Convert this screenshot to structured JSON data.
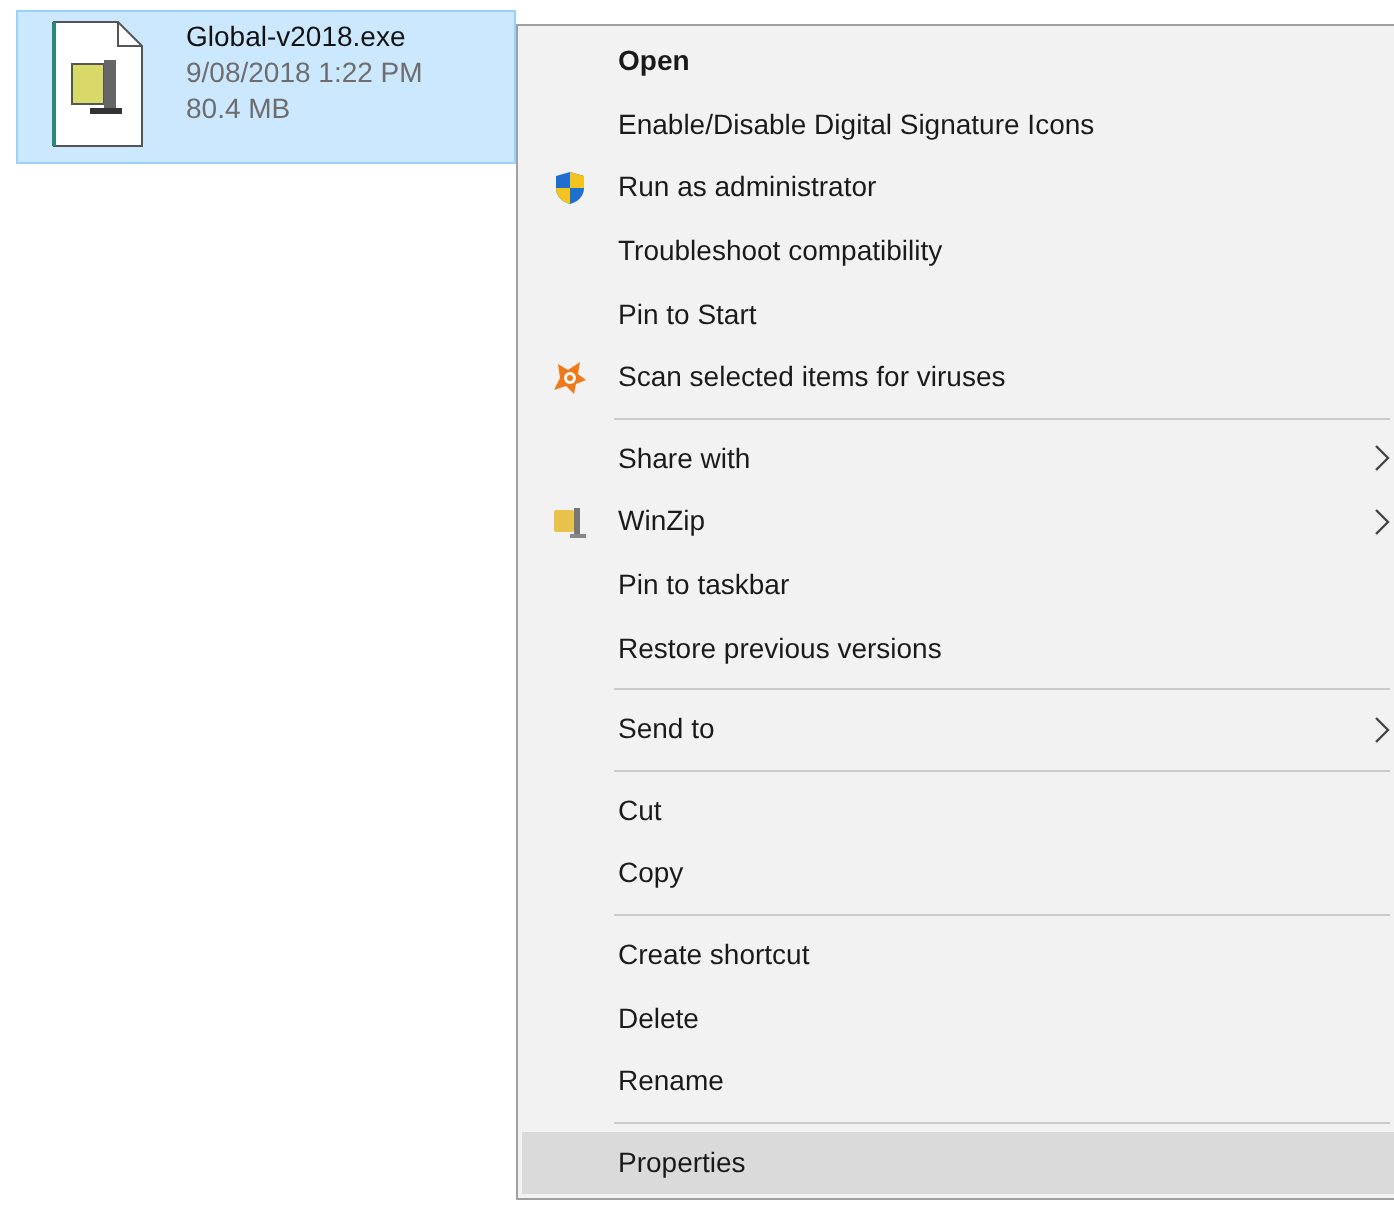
{
  "file": {
    "name": "Global-v2018.exe",
    "modified": "9/08/2018 1:22 PM",
    "size": "80.4 MB",
    "selected": true
  },
  "menu": {
    "groups": [
      [
        {
          "label": "Open",
          "kind": "plain",
          "default": true,
          "submenu": false,
          "selected": false
        },
        {
          "label": "Enable/Disable Digital Signature Icons",
          "kind": "plain",
          "default": false,
          "submenu": false,
          "selected": false
        },
        {
          "label": "Run as administrator",
          "kind": "elevated",
          "default": false,
          "submenu": false,
          "selected": false
        },
        {
          "label": "Troubleshoot compatibility",
          "kind": "plain",
          "default": false,
          "submenu": false,
          "selected": false
        },
        {
          "label": "Pin to Start",
          "kind": "plain",
          "default": false,
          "submenu": false,
          "selected": false
        },
        {
          "label": "Scan selected items for viruses",
          "kind": "scan",
          "default": false,
          "submenu": false,
          "selected": false
        }
      ],
      [
        {
          "label": "Share with",
          "kind": "plain",
          "default": false,
          "submenu": true,
          "selected": false
        },
        {
          "label": "WinZip",
          "kind": "archive",
          "default": false,
          "submenu": true,
          "selected": false
        },
        {
          "label": "Pin to taskbar",
          "kind": "plain",
          "default": false,
          "submenu": false,
          "selected": false
        },
        {
          "label": "Restore previous versions",
          "kind": "plain",
          "default": false,
          "submenu": false,
          "selected": false
        }
      ],
      [
        {
          "label": "Send to",
          "kind": "plain",
          "default": false,
          "submenu": true,
          "selected": false
        }
      ],
      [
        {
          "label": "Cut",
          "kind": "plain",
          "default": false,
          "submenu": false,
          "selected": false
        },
        {
          "label": "Copy",
          "kind": "plain",
          "default": false,
          "submenu": false,
          "selected": false
        }
      ],
      [
        {
          "label": "Create shortcut",
          "kind": "plain",
          "default": false,
          "submenu": false,
          "selected": false
        },
        {
          "label": "Delete",
          "kind": "plain",
          "default": false,
          "submenu": false,
          "selected": false
        },
        {
          "label": "Rename",
          "kind": "plain",
          "default": false,
          "submenu": false,
          "selected": false
        }
      ],
      [
        {
          "label": "Properties",
          "kind": "plain",
          "default": false,
          "submenu": false,
          "selected": true
        }
      ]
    ]
  }
}
